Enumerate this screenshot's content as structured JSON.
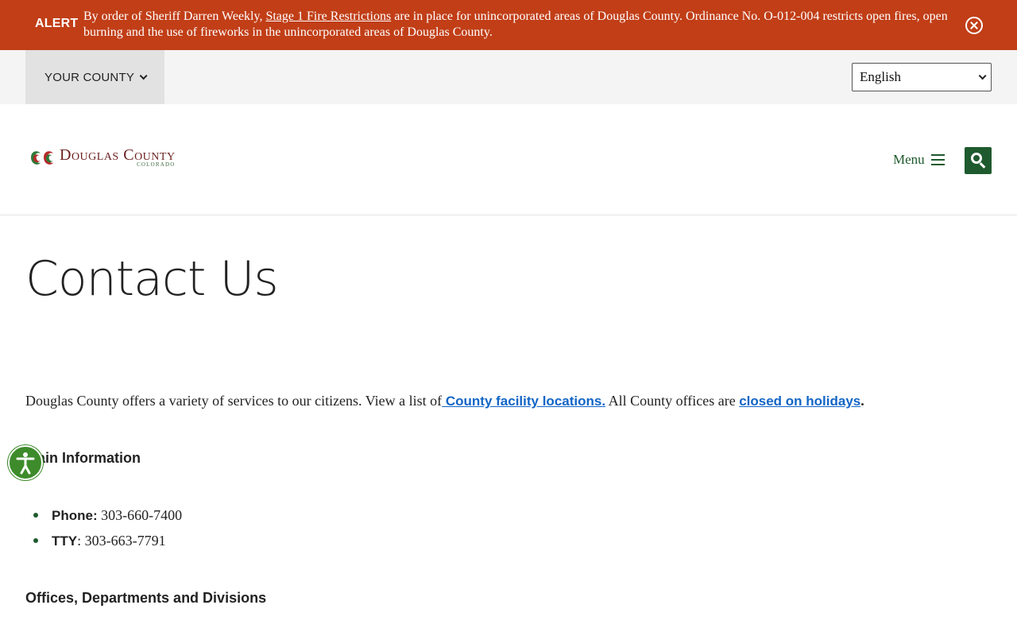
{
  "alert": {
    "label": "ALERT",
    "text_before": "By order of Sheriff Darren Weekly, ",
    "link_text": "Stage 1 Fire Restrictions",
    "text_after": " are in place for unincorporated areas of Douglas County. Ordinance No. O-012-004 restricts open fires, open burning and the use of fireworks in the unincorporated areas of Douglas County.",
    "close_icon": "close-circle-icon"
  },
  "util": {
    "county_label": "YOUR COUNTY",
    "language_selected": "English"
  },
  "header": {
    "logo_name": "Douglas County",
    "logo_sub": "COLORADO",
    "menu_label": "Menu",
    "search_icon": "search-icon"
  },
  "main": {
    "title": "Contact Us",
    "intro_text": "Douglas County offers a variety of services to our citizens.  View a list of",
    "intro_link1": " County facility locations.",
    "intro_mid": " All County offices are ",
    "intro_link2": "closed on holidays",
    "intro_end": ".",
    "main_info_heading": "Main Information",
    "contacts": [
      {
        "label": "Phone:",
        "value": " 303-660-7400"
      },
      {
        "label": "TTY",
        "value": ": 303-663-7791"
      }
    ],
    "offices_heading": "Offices, Departments and Divisions"
  },
  "colors": {
    "alert_bg": "#c13e17",
    "brand_green": "#1e5a2e",
    "link_blue": "#1265c6",
    "a11y_green": "#3d8b2b"
  }
}
